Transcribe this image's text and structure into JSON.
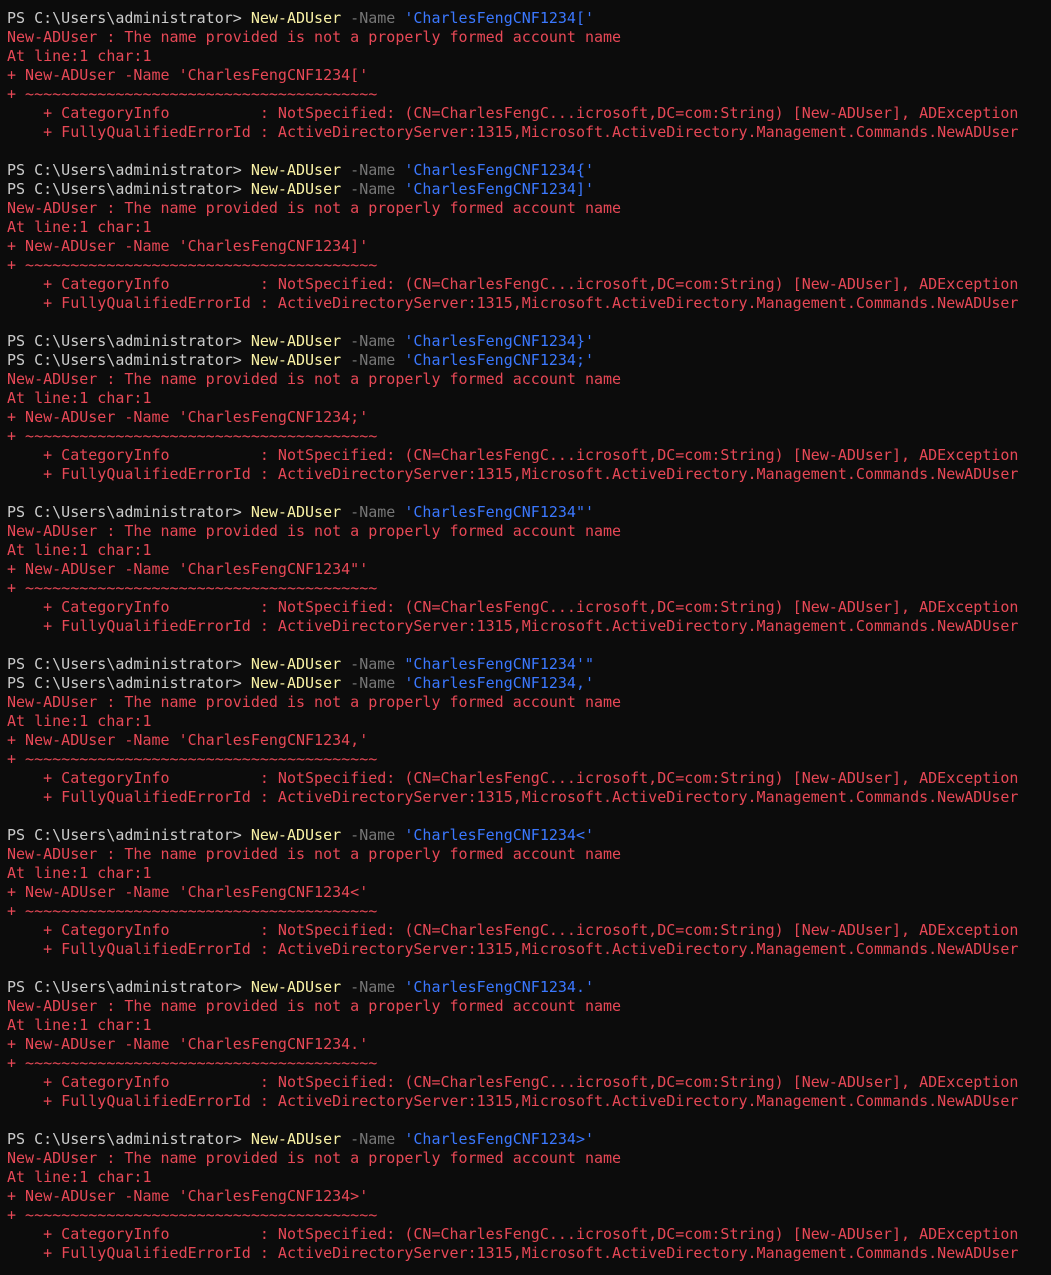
{
  "colors": {
    "background": "#0c0c0c",
    "foreground": "#cccccc",
    "command": "#f9f1a5",
    "parameter": "#767676",
    "string": "#3b78ff",
    "error": "#e74856"
  },
  "lines": [
    {
      "type": "cmd",
      "prompt": "PS C:\\Users\\administrator> ",
      "cmd": "New-ADUser",
      "param": " -Name ",
      "arg": "'CharlesFengCNF1234['"
    },
    {
      "type": "err",
      "text": "New-ADUser : The name provided is not a properly formed account name"
    },
    {
      "type": "err",
      "text": "At line:1 char:1"
    },
    {
      "type": "err",
      "text": "+ New-ADUser -Name 'CharlesFengCNF1234['"
    },
    {
      "type": "err",
      "text": "+ ~~~~~~~~~~~~~~~~~~~~~~~~~~~~~~~~~~~~~~~"
    },
    {
      "type": "err",
      "text": "    + CategoryInfo          : NotSpecified: (CN=CharlesFengC...icrosoft,DC=com:String) [New-ADUser], ADException"
    },
    {
      "type": "err",
      "text": "    + FullyQualifiedErrorId : ActiveDirectoryServer:1315,Microsoft.ActiveDirectory.Management.Commands.NewADUser"
    },
    {
      "type": "blank"
    },
    {
      "type": "cmd",
      "prompt": "PS C:\\Users\\administrator> ",
      "cmd": "New-ADUser",
      "param": " -Name ",
      "arg": "'CharlesFengCNF1234{'"
    },
    {
      "type": "cmd",
      "prompt": "PS C:\\Users\\administrator> ",
      "cmd": "New-ADUser",
      "param": " -Name ",
      "arg": "'CharlesFengCNF1234]'"
    },
    {
      "type": "err",
      "text": "New-ADUser : The name provided is not a properly formed account name"
    },
    {
      "type": "err",
      "text": "At line:1 char:1"
    },
    {
      "type": "err",
      "text": "+ New-ADUser -Name 'CharlesFengCNF1234]'"
    },
    {
      "type": "err",
      "text": "+ ~~~~~~~~~~~~~~~~~~~~~~~~~~~~~~~~~~~~~~~"
    },
    {
      "type": "err",
      "text": "    + CategoryInfo          : NotSpecified: (CN=CharlesFengC...icrosoft,DC=com:String) [New-ADUser], ADException"
    },
    {
      "type": "err",
      "text": "    + FullyQualifiedErrorId : ActiveDirectoryServer:1315,Microsoft.ActiveDirectory.Management.Commands.NewADUser"
    },
    {
      "type": "blank"
    },
    {
      "type": "cmd",
      "prompt": "PS C:\\Users\\administrator> ",
      "cmd": "New-ADUser",
      "param": " -Name ",
      "arg": "'CharlesFengCNF1234}'"
    },
    {
      "type": "cmd",
      "prompt": "PS C:\\Users\\administrator> ",
      "cmd": "New-ADUser",
      "param": " -Name ",
      "arg": "'CharlesFengCNF1234;'"
    },
    {
      "type": "err",
      "text": "New-ADUser : The name provided is not a properly formed account name"
    },
    {
      "type": "err",
      "text": "At line:1 char:1"
    },
    {
      "type": "err",
      "text": "+ New-ADUser -Name 'CharlesFengCNF1234;'"
    },
    {
      "type": "err",
      "text": "+ ~~~~~~~~~~~~~~~~~~~~~~~~~~~~~~~~~~~~~~~"
    },
    {
      "type": "err",
      "text": "    + CategoryInfo          : NotSpecified: (CN=CharlesFengC...icrosoft,DC=com:String) [New-ADUser], ADException"
    },
    {
      "type": "err",
      "text": "    + FullyQualifiedErrorId : ActiveDirectoryServer:1315,Microsoft.ActiveDirectory.Management.Commands.NewADUser"
    },
    {
      "type": "blank"
    },
    {
      "type": "cmd",
      "prompt": "PS C:\\Users\\administrator> ",
      "cmd": "New-ADUser",
      "param": " -Name ",
      "arg": "'CharlesFengCNF1234\"'"
    },
    {
      "type": "err",
      "text": "New-ADUser : The name provided is not a properly formed account name"
    },
    {
      "type": "err",
      "text": "At line:1 char:1"
    },
    {
      "type": "err",
      "text": "+ New-ADUser -Name 'CharlesFengCNF1234\"'"
    },
    {
      "type": "err",
      "text": "+ ~~~~~~~~~~~~~~~~~~~~~~~~~~~~~~~~~~~~~~~"
    },
    {
      "type": "err",
      "text": "    + CategoryInfo          : NotSpecified: (CN=CharlesFengC...icrosoft,DC=com:String) [New-ADUser], ADException"
    },
    {
      "type": "err",
      "text": "    + FullyQualifiedErrorId : ActiveDirectoryServer:1315,Microsoft.ActiveDirectory.Management.Commands.NewADUser"
    },
    {
      "type": "blank"
    },
    {
      "type": "cmd",
      "prompt": "PS C:\\Users\\administrator> ",
      "cmd": "New-ADUser",
      "param": " -Name ",
      "arg": "\"CharlesFengCNF1234'\""
    },
    {
      "type": "cmd",
      "prompt": "PS C:\\Users\\administrator> ",
      "cmd": "New-ADUser",
      "param": " -Name ",
      "arg": "'CharlesFengCNF1234,'"
    },
    {
      "type": "err",
      "text": "New-ADUser : The name provided is not a properly formed account name"
    },
    {
      "type": "err",
      "text": "At line:1 char:1"
    },
    {
      "type": "err",
      "text": "+ New-ADUser -Name 'CharlesFengCNF1234,'"
    },
    {
      "type": "err",
      "text": "+ ~~~~~~~~~~~~~~~~~~~~~~~~~~~~~~~~~~~~~~~"
    },
    {
      "type": "err",
      "text": "    + CategoryInfo          : NotSpecified: (CN=CharlesFengC...icrosoft,DC=com:String) [New-ADUser], ADException"
    },
    {
      "type": "err",
      "text": "    + FullyQualifiedErrorId : ActiveDirectoryServer:1315,Microsoft.ActiveDirectory.Management.Commands.NewADUser"
    },
    {
      "type": "blank"
    },
    {
      "type": "cmd",
      "prompt": "PS C:\\Users\\administrator> ",
      "cmd": "New-ADUser",
      "param": " -Name ",
      "arg": "'CharlesFengCNF1234<'"
    },
    {
      "type": "err",
      "text": "New-ADUser : The name provided is not a properly formed account name"
    },
    {
      "type": "err",
      "text": "At line:1 char:1"
    },
    {
      "type": "err",
      "text": "+ New-ADUser -Name 'CharlesFengCNF1234<'"
    },
    {
      "type": "err",
      "text": "+ ~~~~~~~~~~~~~~~~~~~~~~~~~~~~~~~~~~~~~~~"
    },
    {
      "type": "err",
      "text": "    + CategoryInfo          : NotSpecified: (CN=CharlesFengC...icrosoft,DC=com:String) [New-ADUser], ADException"
    },
    {
      "type": "err",
      "text": "    + FullyQualifiedErrorId : ActiveDirectoryServer:1315,Microsoft.ActiveDirectory.Management.Commands.NewADUser"
    },
    {
      "type": "blank"
    },
    {
      "type": "cmd",
      "prompt": "PS C:\\Users\\administrator> ",
      "cmd": "New-ADUser",
      "param": " -Name ",
      "arg": "'CharlesFengCNF1234.'"
    },
    {
      "type": "err",
      "text": "New-ADUser : The name provided is not a properly formed account name"
    },
    {
      "type": "err",
      "text": "At line:1 char:1"
    },
    {
      "type": "err",
      "text": "+ New-ADUser -Name 'CharlesFengCNF1234.'"
    },
    {
      "type": "err",
      "text": "+ ~~~~~~~~~~~~~~~~~~~~~~~~~~~~~~~~~~~~~~~"
    },
    {
      "type": "err",
      "text": "    + CategoryInfo          : NotSpecified: (CN=CharlesFengC...icrosoft,DC=com:String) [New-ADUser], ADException"
    },
    {
      "type": "err",
      "text": "    + FullyQualifiedErrorId : ActiveDirectoryServer:1315,Microsoft.ActiveDirectory.Management.Commands.NewADUser"
    },
    {
      "type": "blank"
    },
    {
      "type": "cmd",
      "prompt": "PS C:\\Users\\administrator> ",
      "cmd": "New-ADUser",
      "param": " -Name ",
      "arg": "'CharlesFengCNF1234>'"
    },
    {
      "type": "err",
      "text": "New-ADUser : The name provided is not a properly formed account name"
    },
    {
      "type": "err",
      "text": "At line:1 char:1"
    },
    {
      "type": "err",
      "text": "+ New-ADUser -Name 'CharlesFengCNF1234>'"
    },
    {
      "type": "err",
      "text": "+ ~~~~~~~~~~~~~~~~~~~~~~~~~~~~~~~~~~~~~~~"
    },
    {
      "type": "err",
      "text": "    + CategoryInfo          : NotSpecified: (CN=CharlesFengC...icrosoft,DC=com:String) [New-ADUser], ADException"
    },
    {
      "type": "err",
      "text": "    + FullyQualifiedErrorId : ActiveDirectoryServer:1315,Microsoft.ActiveDirectory.Management.Commands.NewADUser"
    }
  ]
}
